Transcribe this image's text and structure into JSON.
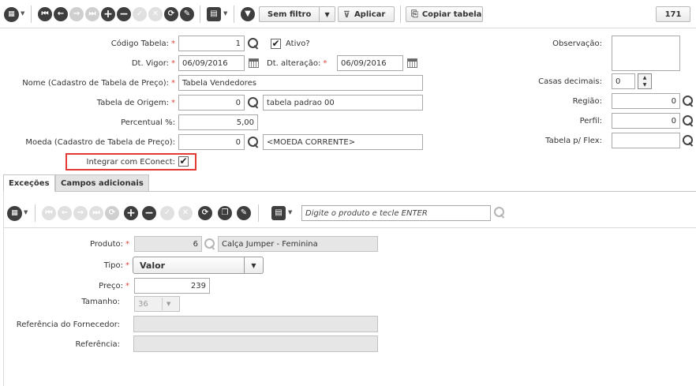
{
  "toolbar": {
    "filter_label": "Sem filtro",
    "apply_label": "Aplicar",
    "copy_label": "Copiar tabela",
    "record_count": "171"
  },
  "form": {
    "codigo": {
      "label": "Código Tabela:",
      "value": "1"
    },
    "ativo": {
      "label": "Ativo?",
      "checked": "✔"
    },
    "observacao": {
      "label": "Observação:"
    },
    "dt_vigor": {
      "label": "Dt. Vigor:",
      "value": "06/09/2016"
    },
    "dt_alteracao": {
      "label": "Dt. alteração:",
      "value": "06/09/2016"
    },
    "nome": {
      "label": "Nome (Cadastro de Tabela de Preço):",
      "value": "Tabela Vendedores"
    },
    "casas": {
      "label": "Casas decimais:",
      "value": "0"
    },
    "origem": {
      "label": "Tabela de Origem:",
      "code": "0",
      "desc": "tabela padrao 00"
    },
    "regiao": {
      "label": "Região:",
      "value": "0"
    },
    "percentual": {
      "label": "Percentual %:",
      "value": "5,00"
    },
    "perfil": {
      "label": "Perfil:",
      "value": "0"
    },
    "moeda": {
      "label": "Moeda (Cadastro de Tabela de Preço):",
      "code": "0",
      "desc": "<MOEDA CORRENTE>"
    },
    "flex": {
      "label": "Tabela p/ Flex:",
      "value": ""
    },
    "econect": {
      "label": "Integrar com EConect:",
      "checked": "✔"
    }
  },
  "tabs": [
    {
      "label": "Exceções"
    },
    {
      "label": "Campos adicionais"
    }
  ],
  "subtoolbar": {
    "search_placeholder": "Digite o produto e tecle ENTER"
  },
  "detail": {
    "produto": {
      "label": "Produto:",
      "code": "6",
      "desc": "Calça Jumper - Feminina"
    },
    "tipo": {
      "label": "Tipo:",
      "value": "Valor"
    },
    "preco": {
      "label": "Preço:",
      "value": "239"
    },
    "tamanho": {
      "label": "Tamanho:",
      "value": "36"
    },
    "ref_fornecedor": {
      "label": "Referência do Fornecedor:",
      "value": ""
    },
    "referencia": {
      "label": "Referência:",
      "value": ""
    }
  },
  "colors": {
    "accent_red": "#e53935",
    "required": "#e0463c"
  }
}
